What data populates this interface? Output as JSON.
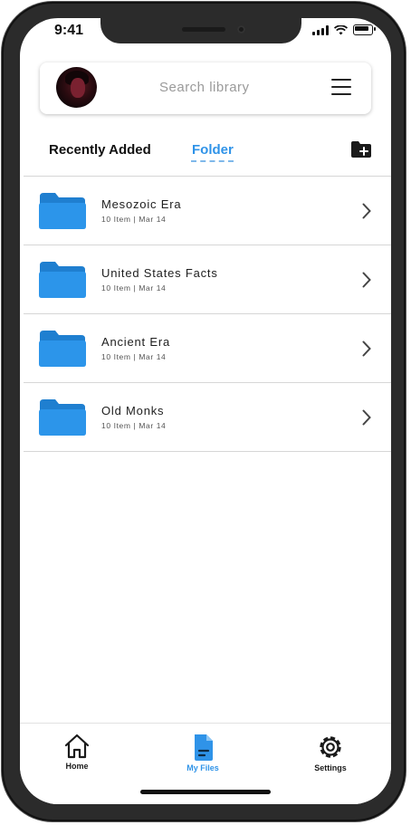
{
  "status_bar": {
    "time": "9:41"
  },
  "search": {
    "placeholder": "Search library"
  },
  "tabs": [
    {
      "label": "Recently Added",
      "active": false
    },
    {
      "label": "Folder",
      "active": true
    }
  ],
  "folders": [
    {
      "name": "Mesozoic Era",
      "items": "10 Item",
      "date": "Mar 14"
    },
    {
      "name": "United States Facts",
      "items": "10 Item",
      "date": "Mar 14"
    },
    {
      "name": "Ancient Era",
      "items": "10 Item",
      "date": "Mar 14"
    },
    {
      "name": "Old Monks",
      "items": "10 Item",
      "date": "Mar 14"
    }
  ],
  "meta_separator": "|",
  "bottom_nav": [
    {
      "label": "Home",
      "icon": "home-icon",
      "active": false
    },
    {
      "label": "My Files",
      "icon": "file-icon",
      "active": true
    },
    {
      "label": "Settings",
      "icon": "gear-icon",
      "active": false
    }
  ],
  "colors": {
    "accent": "#2F93E8",
    "folder": "#2C95EA",
    "text": "#1E1E1E",
    "muted": "#9A9A9A",
    "frame": "#2B2B2B"
  }
}
